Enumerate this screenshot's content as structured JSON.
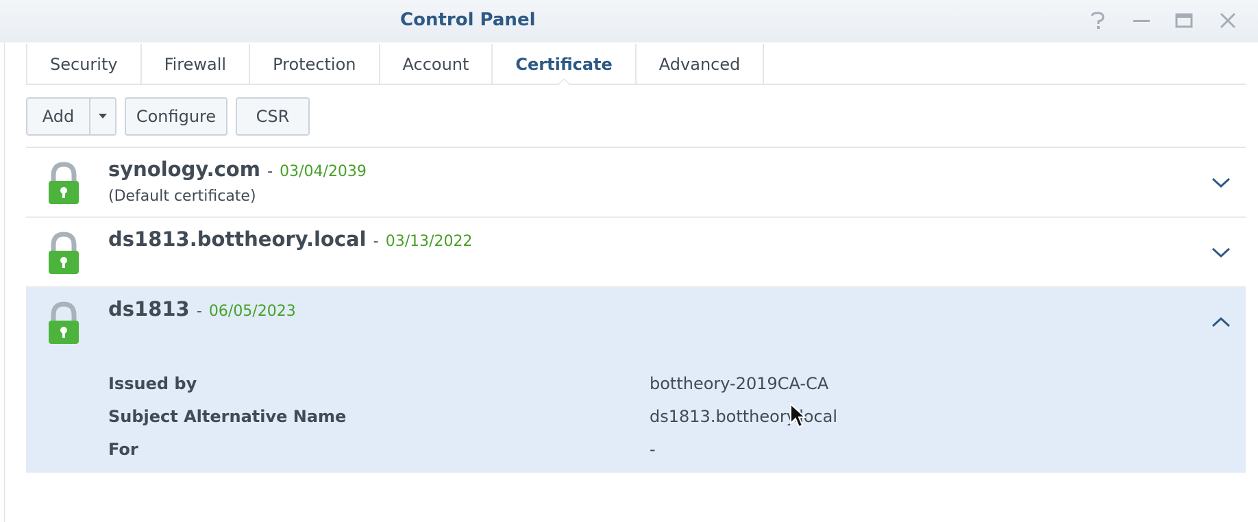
{
  "window": {
    "title": "Control Panel",
    "controls": [
      "help-icon",
      "minimize-icon",
      "maximize-icon",
      "close-icon"
    ]
  },
  "tabs": [
    {
      "label": "Security",
      "active": false
    },
    {
      "label": "Firewall",
      "active": false
    },
    {
      "label": "Protection",
      "active": false
    },
    {
      "label": "Account",
      "active": false
    },
    {
      "label": "Certificate",
      "active": true
    },
    {
      "label": "Advanced",
      "active": false
    }
  ],
  "toolbar": {
    "add_label": "Add",
    "configure_label": "Configure",
    "csr_label": "CSR"
  },
  "certificates": [
    {
      "name": "synology.com",
      "separator": "-",
      "expiry": "03/04/2039",
      "note": "(Default certificate)",
      "expanded": false
    },
    {
      "name": "ds1813.bottheory.local",
      "separator": "-",
      "expiry": "03/13/2022",
      "note": "",
      "expanded": false
    },
    {
      "name": "ds1813",
      "separator": "-",
      "expiry": "06/05/2023",
      "note": "",
      "expanded": true,
      "details": [
        {
          "label": "Issued by",
          "value": "bottheory-2019CA-CA"
        },
        {
          "label": "Subject Alternative Name",
          "value": "ds1813.bottheory.local"
        },
        {
          "label": "For",
          "value": "-"
        }
      ]
    }
  ],
  "colors": {
    "title": "#2e5985",
    "active_tab": "#2e5985",
    "date_green": "#47a027",
    "lock_green": "#4cb43c",
    "expanded_row_bg": "#e1ecf8"
  }
}
